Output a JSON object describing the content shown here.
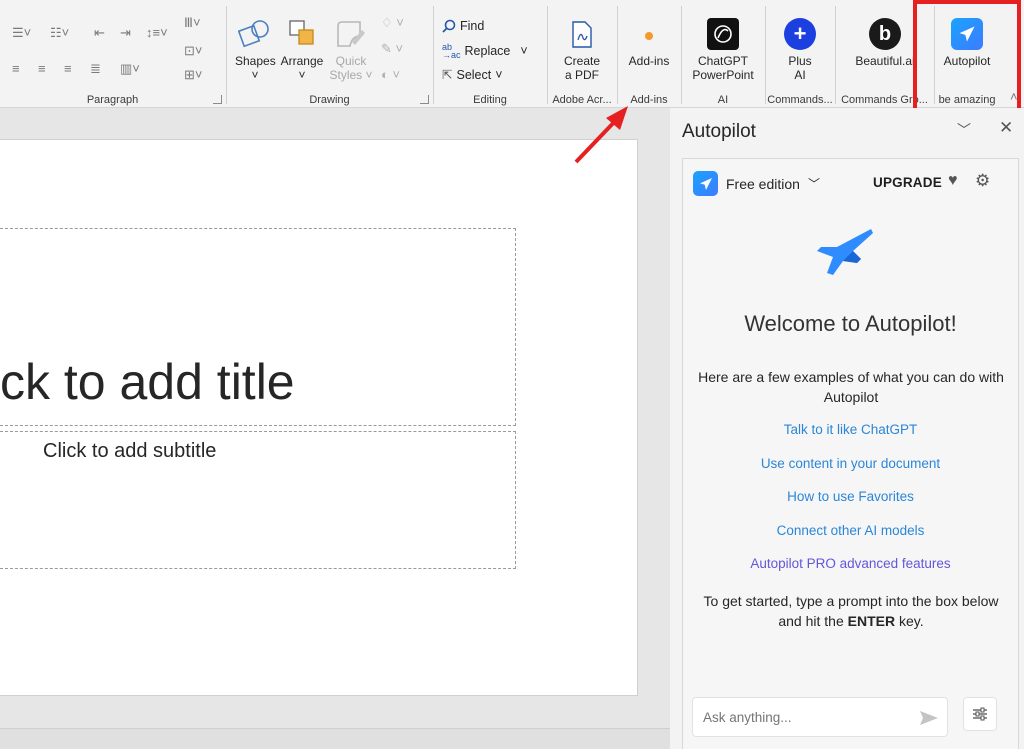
{
  "ribbon": {
    "groups": {
      "paragraph": "Paragraph",
      "drawing": "Drawing",
      "editing": "Editing",
      "adobe": "Adobe Acr...",
      "addins": "Add-ins",
      "ai": "AI",
      "commands": "Commands...",
      "commands_gr": "Commands Gro...",
      "be_amazing": "be amazing"
    },
    "drawing": {
      "shapes": "Shapes",
      "arrange": "Arrange",
      "quick_styles_1": "Quick",
      "quick_styles_2": "Styles"
    },
    "editing": {
      "find": "Find",
      "replace": "Replace",
      "select": "Select"
    },
    "buttons": {
      "create_pdf_1": "Create",
      "create_pdf_2": "a PDF",
      "addins": "Add-ins",
      "chatgpt_1": "ChatGPT",
      "chatgpt_2": "PowerPoint",
      "plus_1": "Plus",
      "plus_2": "AI",
      "beautiful": "Beautiful.ai",
      "autopilot": "Autopilot"
    }
  },
  "slide": {
    "title_placeholder": "ck to add title",
    "subtitle_placeholder": "Click to add subtitle"
  },
  "pane": {
    "title": "Autopilot",
    "edition": "Free edition",
    "upgrade": "UPGRADE",
    "welcome": "Welcome to Autopilot!",
    "intro": "Here are a few examples of what you can do with Autopilot",
    "links": [
      "Talk to it like ChatGPT",
      "Use content in your document",
      "How to use Favorites",
      "Connect other AI models",
      "Autopilot PRO advanced features"
    ],
    "get_started_pre": "To get started, type a prompt into the box below and hit the ",
    "get_started_key": "ENTER",
    "get_started_post": " key.",
    "ask_placeholder": "Ask anything..."
  },
  "colors": {
    "highlight": "#e62020",
    "link": "#2b86d8",
    "pro_link": "#6257d9",
    "brand_blue": "#2f8cff"
  }
}
